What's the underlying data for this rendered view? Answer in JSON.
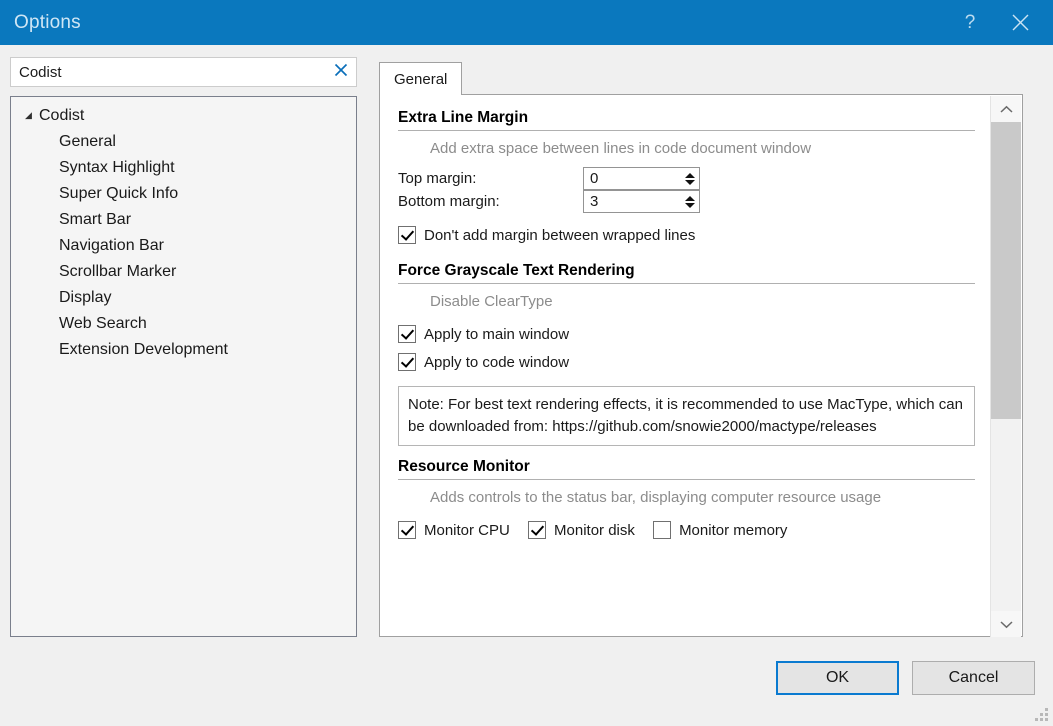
{
  "window": {
    "title": "Options",
    "help_icon": "question-mark-icon",
    "close_icon": "close-icon"
  },
  "search": {
    "value": "Codist",
    "placeholder": "Search",
    "clear_icon": "clear-x-icon"
  },
  "tree": {
    "root": {
      "label": "Codist",
      "expander": "◢"
    },
    "items": [
      {
        "label": "General"
      },
      {
        "label": "Syntax Highlight"
      },
      {
        "label": "Super Quick Info"
      },
      {
        "label": "Smart Bar"
      },
      {
        "label": "Navigation Bar"
      },
      {
        "label": "Scrollbar Marker"
      },
      {
        "label": "Display"
      },
      {
        "label": "Web Search"
      },
      {
        "label": "Extension Development"
      }
    ]
  },
  "tabs": [
    {
      "label": "General",
      "selected": true
    }
  ],
  "sections": {
    "extra_line_margin": {
      "title": "Extra Line Margin",
      "description": "Add extra space between lines in code document window",
      "top_margin_label": "Top margin:",
      "top_margin_value": "0",
      "bottom_margin_label": "Bottom margin:",
      "bottom_margin_value": "3",
      "no_wrap_margin_label": "Don't add margin between wrapped lines"
    },
    "grayscale": {
      "title": "Force Grayscale Text Rendering",
      "description": "Disable ClearType",
      "main_window_label": "Apply to main window",
      "code_window_label": "Apply to code window",
      "note": "Note: For best text rendering effects, it is recommended to use MacType, which can be downloaded from: https://github.com/snowie2000/mactype/releases"
    },
    "resource_monitor": {
      "title": "Resource Monitor",
      "description": "Adds controls to the status bar, displaying computer resource usage",
      "cpu_label": "Monitor CPU",
      "disk_label": "Monitor disk",
      "memory_label": "Monitor memory"
    }
  },
  "scrollbar": {
    "up_icon": "chevron-up-icon",
    "down_icon": "chevron-down-icon"
  },
  "footer": {
    "ok_label": "OK",
    "cancel_label": "Cancel",
    "resize_grip_icon": "resize-grip-icon"
  },
  "colors": {
    "titlebar": "#0a78be",
    "accent": "#0a7ad0",
    "dialog_bg": "#f0f0f0",
    "panel_bg": "#ffffff",
    "muted_text": "#8c8c8c"
  }
}
